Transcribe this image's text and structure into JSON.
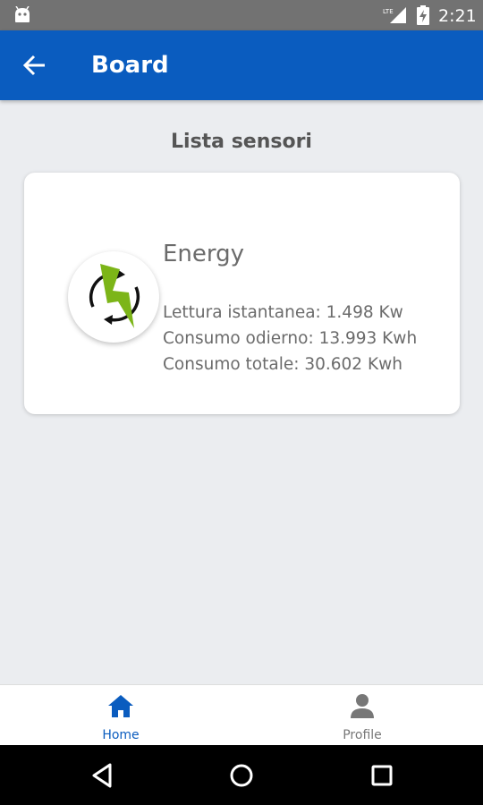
{
  "status_bar": {
    "time": "2:21",
    "icons": [
      "android-icon",
      "lte-signal-icon",
      "battery-charging-icon"
    ]
  },
  "app_bar": {
    "title": "Board",
    "back_icon": "arrow-back-icon"
  },
  "section": {
    "title": "Lista sensori"
  },
  "sensors": [
    {
      "name": "Energy",
      "icon": "energy-bolt-icon",
      "lines": [
        "Lettura istantanea: 1.498 Kw",
        "Consumo odierno: 13.993 Kwh",
        "Consumo totale: 30.602 Kwh"
      ]
    }
  ],
  "bottom_nav": {
    "items": [
      {
        "label": "Home",
        "icon": "home-icon",
        "active": true
      },
      {
        "label": "Profile",
        "icon": "person-icon",
        "active": false
      }
    ]
  },
  "colors": {
    "primary": "#0a5cbf",
    "background": "#ebedf0",
    "status_bar": "#727272",
    "bolt_green": "#7cb518"
  }
}
